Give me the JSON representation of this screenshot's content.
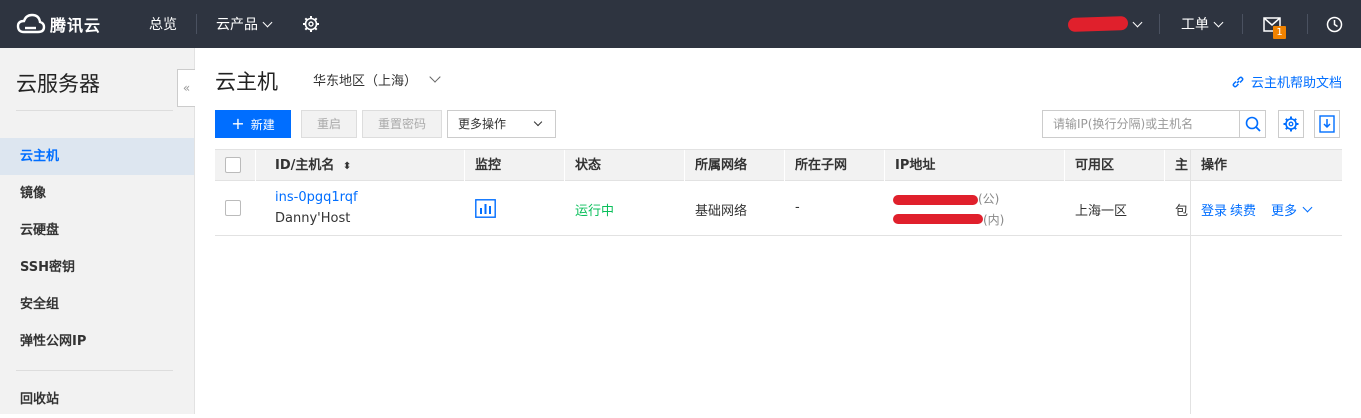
{
  "topbar": {
    "brand": "腾讯云",
    "overview": "总览",
    "products": "云产品",
    "ticket": "工单",
    "mail_badge": "1"
  },
  "sidebar": {
    "title": "云服务器",
    "collapse": "«",
    "items": [
      {
        "label": "云主机",
        "active": true
      },
      {
        "label": "镜像"
      },
      {
        "label": "云硬盘"
      },
      {
        "label": "SSH密钥"
      },
      {
        "label": "安全组"
      },
      {
        "label": "弹性公网IP"
      },
      {
        "label": "回收站"
      }
    ]
  },
  "main": {
    "title": "云主机",
    "region": "华东地区（上海）",
    "help_link": "云主机帮助文档",
    "toolbar": {
      "new_label": "新建",
      "restart_label": "重启",
      "reset_pwd_label": "重置密码",
      "more_ops_label": "更多操作",
      "search_placeholder": "请输IP(换行分隔)或主机名"
    },
    "table": {
      "headers": {
        "id_name": "ID/主机名",
        "monitor": "监控",
        "status": "状态",
        "network": "所属网络",
        "subnet": "所在子网",
        "ip": "IP地址",
        "zone": "可用区",
        "host_type": "主",
        "actions": "操作"
      },
      "rows": [
        {
          "id": "ins-0pgq1rqf",
          "name": "Danny'Host",
          "status": "运行中",
          "network": "基础网络",
          "subnet": "-",
          "ip_public_suffix": "(公)",
          "ip_private_suffix": "(内)",
          "zone": "上海一区",
          "host_type": "包",
          "action_login": "登录",
          "action_renew": "续费",
          "action_more": "更多"
        }
      ]
    }
  },
  "colors": {
    "topbar_bg": "#2e3440",
    "accent": "#006eff",
    "status_running": "#0abf5b",
    "badge": "#f08200"
  }
}
